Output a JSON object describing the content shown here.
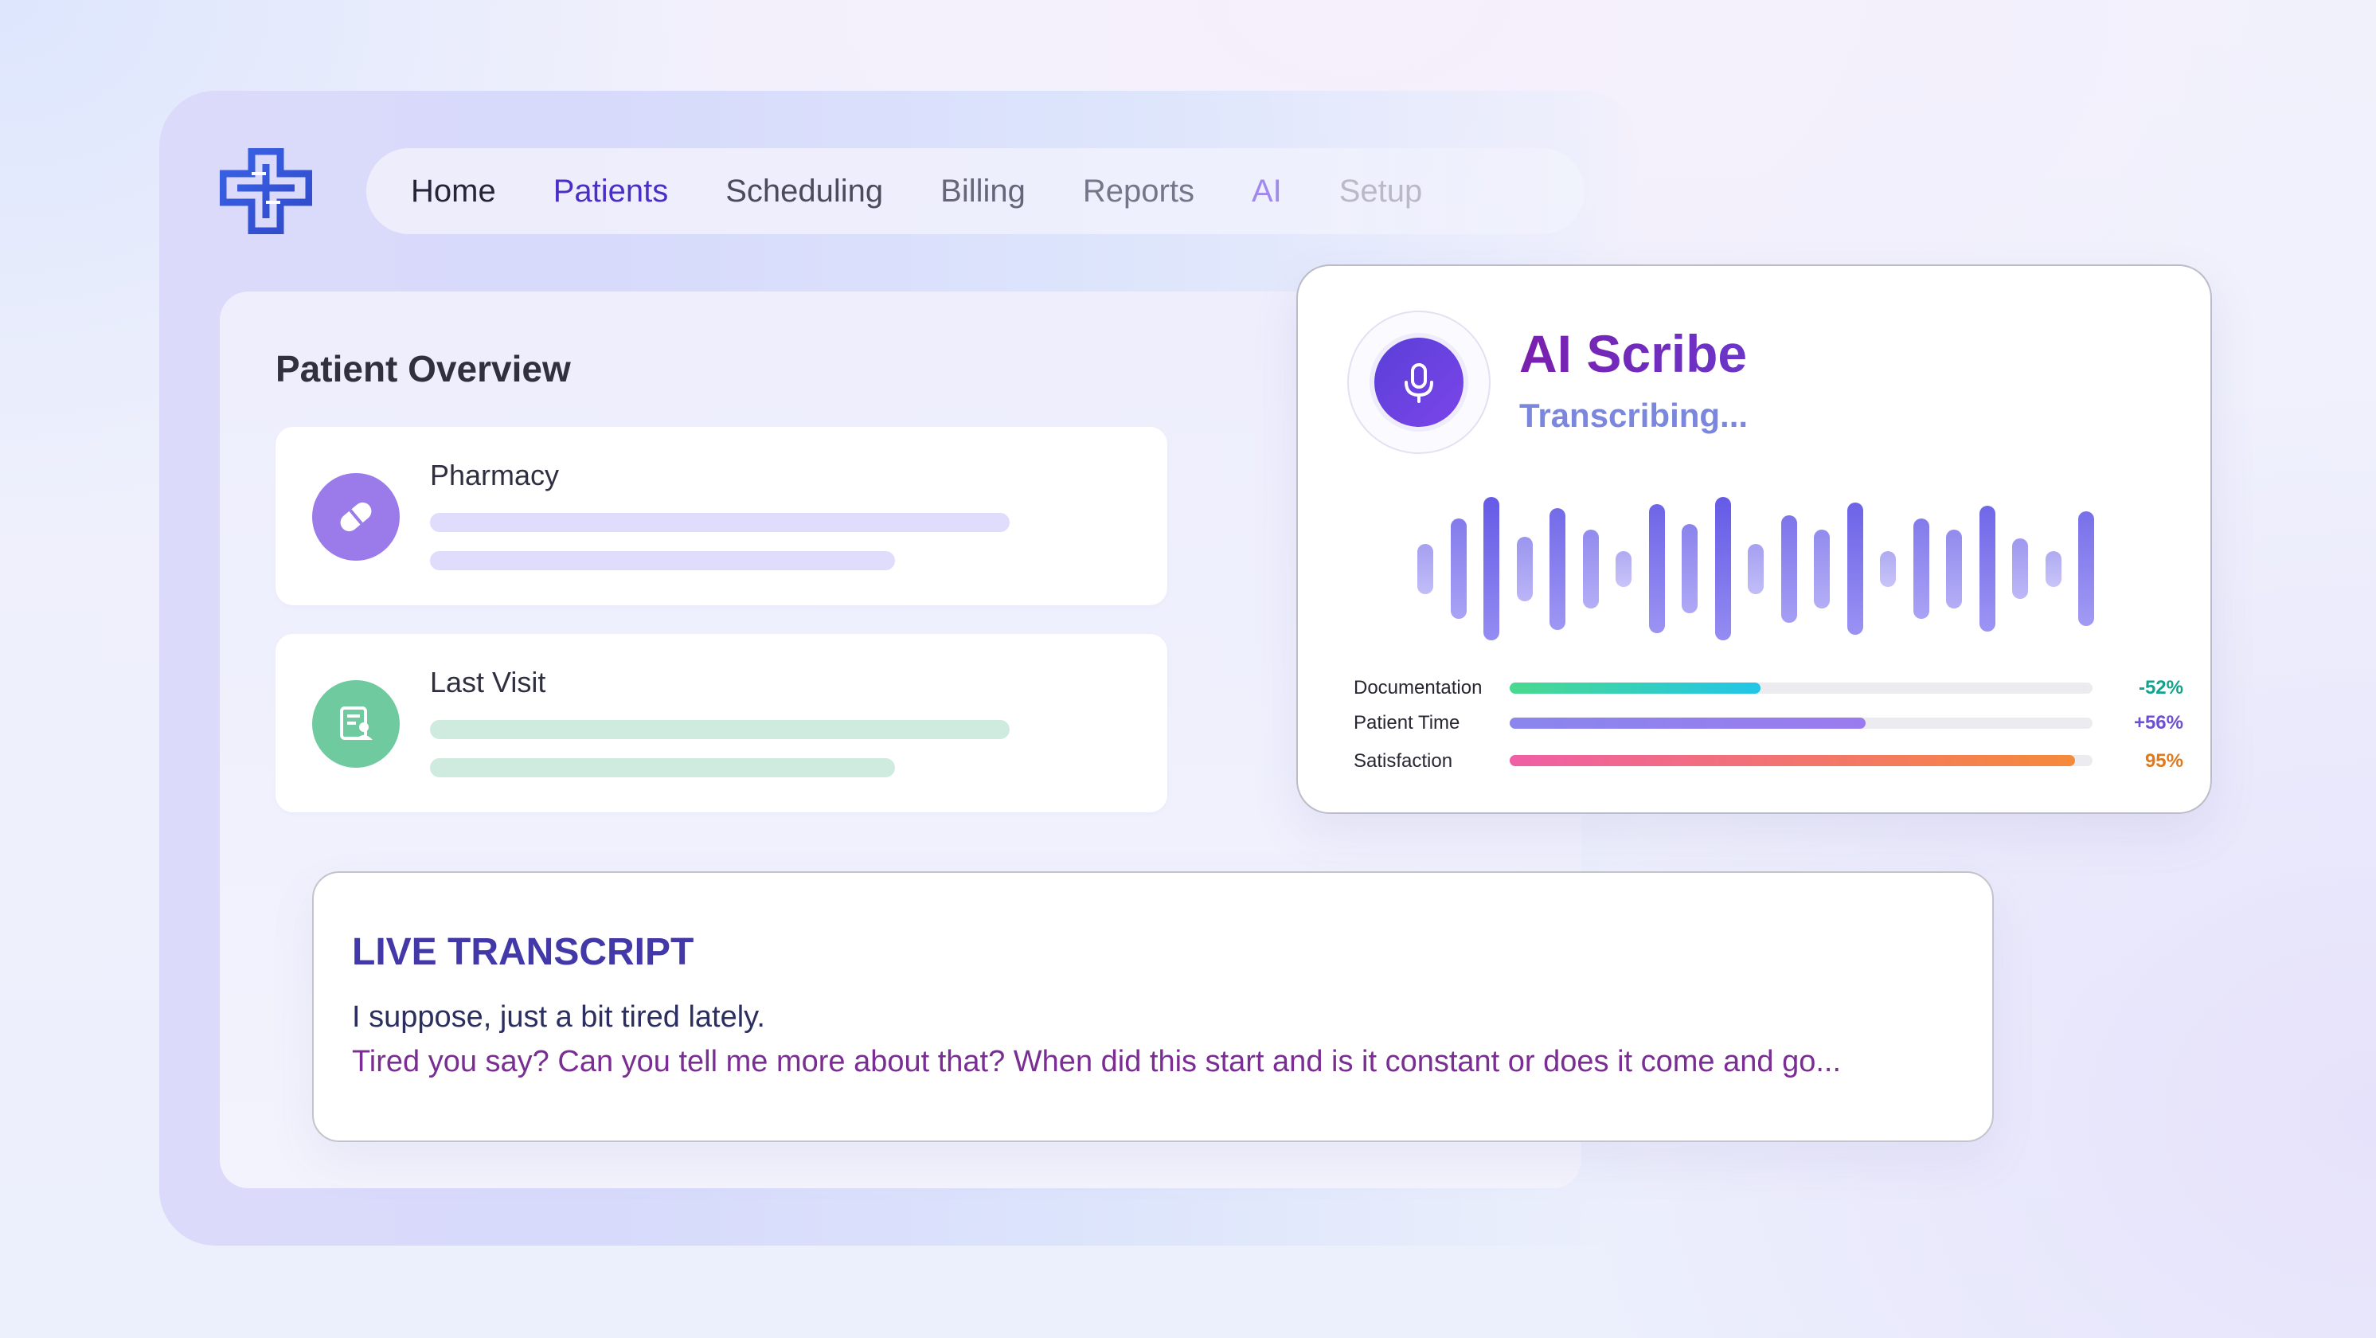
{
  "nav": {
    "items": [
      {
        "label": "Home"
      },
      {
        "label": "Patients"
      },
      {
        "label": "Scheduling"
      },
      {
        "label": "Billing"
      },
      {
        "label": "Reports"
      },
      {
        "label": "AI"
      },
      {
        "label": "Setup"
      }
    ],
    "active": "Patients"
  },
  "logo": {
    "icon": "medical-cross-logo",
    "color": "#3d5fe0"
  },
  "overview": {
    "title": "Patient Overview",
    "cards": [
      {
        "title": "Pharmacy",
        "icon": "pill-icon",
        "icon_color": "#9b7bea",
        "bar_color": "#e0dcfb"
      },
      {
        "title": "Last Visit",
        "icon": "medical-record-icon",
        "icon_color": "#6fcb9f",
        "bar_color": "#cfeade"
      }
    ]
  },
  "scribe": {
    "title": "AI Scribe",
    "status": "Transcribing...",
    "icon": "microphone-icon",
    "waveform_levels": [
      0.35,
      0.7,
      1.0,
      0.45,
      0.85,
      0.55,
      0.25,
      0.9,
      0.62,
      1.0,
      0.35,
      0.75,
      0.55,
      0.92,
      0.25,
      0.7,
      0.55,
      0.88,
      0.42,
      0.25,
      0.8
    ],
    "metrics": [
      {
        "label": "Documentation",
        "value": "-52%",
        "fill": 0.43,
        "color_start": "#4ad98e",
        "color_end": "#22c5e8",
        "value_color": "#12a38c"
      },
      {
        "label": "Patient Time",
        "value": "+56%",
        "fill": 0.61,
        "color_start": "#8a86ee",
        "color_end": "#9b7bef",
        "value_color": "#6d4fd3"
      },
      {
        "label": "Satisfaction",
        "value": "95%",
        "fill": 0.97,
        "color_start": "#ef5fa5",
        "color_end": "#f58a3a",
        "value_color": "#e0791c"
      }
    ]
  },
  "transcript": {
    "title": "LIVE TRANSCRIPT",
    "lines": [
      "I suppose, just a bit tired lately.",
      "Tired you say? Can you tell me more about that? When did this start and is it constant or does it come and go..."
    ]
  }
}
